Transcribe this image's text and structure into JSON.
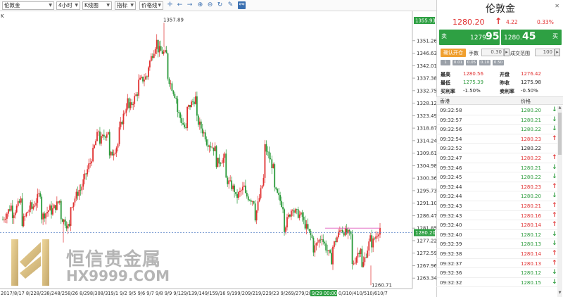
{
  "toolbar": {
    "symbol": "伦敦金",
    "period": "4小时",
    "chart_type": "K线图",
    "indicator": "指标",
    "price_line": "价格线",
    "icons": [
      "crosshair-icon",
      "arrow-left-icon",
      "arrow-right-icon",
      "zoom-in-icon",
      "zoom-out-icon",
      "refresh-icon",
      "pencil-icon",
      "link-icon"
    ]
  },
  "chart_label": "K",
  "watermark": {
    "cn": "恒信贵金属",
    "en": "HX9999.COM"
  },
  "chart_data": {
    "type": "candlestick",
    "y_ticks": [
      1263.34,
      1267.96,
      1272.59,
      1277.22,
      1281.85,
      1286.47,
      1291.1,
      1295.73,
      1300.36,
      1304.98,
      1309.61,
      1314.24,
      1318.87,
      1323.49,
      1328.12,
      1332.75,
      1337.38,
      1342.01,
      1346.63,
      1351.26
    ],
    "y_range": [
      1260.0,
      1358.5
    ],
    "current_price_label": "1280.20",
    "top_label": "1355.93",
    "reference_line_value": 1280.2,
    "resistance_line_value": 1281.85,
    "high_annotation": {
      "label": "1357.89",
      "value": 1357.89
    },
    "low_annotation": {
      "label": "1260.71",
      "value": 1260.71
    },
    "x_labels": [
      "2017/8/17",
      "8/22",
      "8/23",
      "8/24",
      "8/25",
      "8/26",
      "8/29",
      "8/30",
      "8/31",
      "9/1",
      "9/2",
      "9/5",
      "9/6",
      "9/7",
      "9/8",
      "9/9",
      "9/12",
      "9/13",
      "9/14",
      "9/15",
      "9/16",
      "9/19",
      "9/20",
      "9/21",
      "9/22",
      "9/23",
      "9/26",
      "9/27",
      "9/28",
      "9/29 00:00",
      "10/3",
      "10/4",
      "10/5",
      "10/6",
      "10/7"
    ],
    "x_label_text": "2017/8/17  8/228/238/248/258/26  8/298/308/319/1  9/2  9/5  9/6  9/7  9/8  9/9  9/129/139/149/159/16  9/199/209/219/229/23  9/269/279/28",
    "x_label_highlight": "9/29 00:00",
    "x_label_tail": "0/310/410/510/610/7",
    "waypoints": [
      [
        1285,
        1290
      ],
      [
        1287,
        1292
      ],
      [
        1284,
        1290
      ],
      [
        1289,
        1295
      ],
      [
        1286,
        1289
      ],
      [
        1288,
        1292
      ],
      [
        1286,
        1282
      ],
      [
        1290,
        1296
      ],
      [
        1296,
        1305
      ],
      [
        1306,
        1318
      ],
      [
        1314,
        1318
      ],
      [
        1308,
        1313
      ],
      [
        1318,
        1329
      ],
      [
        1326,
        1332
      ],
      [
        1336,
        1338
      ],
      [
        1342,
        1351
      ],
      [
        1348,
        1346
      ],
      [
        1338,
        1330
      ],
      [
        1325,
        1318
      ],
      [
        1326,
        1330
      ],
      [
        1322,
        1316
      ],
      [
        1314,
        1311
      ],
      [
        1306,
        1308
      ],
      [
        1300,
        1296
      ],
      [
        1293,
        1297
      ],
      [
        1294,
        1292
      ],
      [
        1286,
        1300
      ],
      [
        1312,
        1304
      ],
      [
        1296,
        1290
      ],
      [
        1282,
        1290
      ],
      [
        1288,
        1286
      ],
      [
        1284,
        1278
      ],
      [
        1274,
        1279
      ],
      [
        1277,
        1270
      ],
      [
        1275,
        1282
      ],
      [
        1281,
        1279
      ],
      [
        1268,
        1275
      ],
      [
        1267,
        1278
      ],
      [
        1276,
        1282
      ]
    ]
  },
  "panel": {
    "title": "伦敦金",
    "price": "1280.20",
    "change": "4.22",
    "change_pct": "0.33%",
    "sell": {
      "side": "卖",
      "small": "1279.",
      "big": "95"
    },
    "buy": {
      "side": "买",
      "small": "1280.",
      "big": "45"
    },
    "confirm_label": "确认开仓",
    "lots_label": "手数",
    "lots_value": "0.30",
    "range_label": "成交范围",
    "range_value": "100",
    "chips": [
      "1",
      "0.01",
      "0.05",
      "0.10",
      "0.50"
    ],
    "stats": [
      {
        "label": "最高",
        "value": "1280.56",
        "color": "red"
      },
      {
        "label": "开盘",
        "value": "1276.42",
        "color": "red"
      },
      {
        "label": "最低",
        "value": "1275.39",
        "color": "green"
      },
      {
        "label": "昨收",
        "value": "1275.98",
        "color": "dark"
      },
      {
        "label": "买利率",
        "value": "-1.50%",
        "color": "dark"
      },
      {
        "label": "卖利率",
        "value": "-0.50%",
        "color": "dark"
      }
    ],
    "tick_headers": [
      "香港",
      "价格"
    ],
    "ticks": [
      {
        "time": "09:32:58",
        "price": "1280.20",
        "dir": "down"
      },
      {
        "time": "09:32:57",
        "price": "1280.21",
        "dir": "down"
      },
      {
        "time": "09:32:56",
        "price": "1280.22",
        "dir": "down"
      },
      {
        "time": "09:32:54",
        "price": "1280.23",
        "dir": "up"
      },
      {
        "time": "09:32:52",
        "price": "1280.22",
        "dir": "none"
      },
      {
        "time": "09:32:47",
        "price": "1280.22",
        "dir": "up"
      },
      {
        "time": "09:32:46",
        "price": "1280.21",
        "dir": "down"
      },
      {
        "time": "09:32:45",
        "price": "1280.22",
        "dir": "down"
      },
      {
        "time": "09:32:44",
        "price": "1280.23",
        "dir": "up"
      },
      {
        "time": "09:32:44",
        "price": "1280.20",
        "dir": "down"
      },
      {
        "time": "09:32:43",
        "price": "1280.21",
        "dir": "up"
      },
      {
        "time": "09:32:43",
        "price": "1280.16",
        "dir": "up"
      },
      {
        "time": "09:32:40",
        "price": "1280.14",
        "dir": "up"
      },
      {
        "time": "09:32:40",
        "price": "1280.12",
        "dir": "down"
      },
      {
        "time": "09:32:39",
        "price": "1280.13",
        "dir": "down"
      },
      {
        "time": "09:32:38",
        "price": "1280.14",
        "dir": "up"
      },
      {
        "time": "09:32:37",
        "price": "1280.13",
        "dir": "up"
      },
      {
        "time": "09:32:36",
        "price": "1280.12",
        "dir": "down"
      },
      {
        "time": "09:32:32",
        "price": "1280.15",
        "dir": "down"
      }
    ]
  }
}
